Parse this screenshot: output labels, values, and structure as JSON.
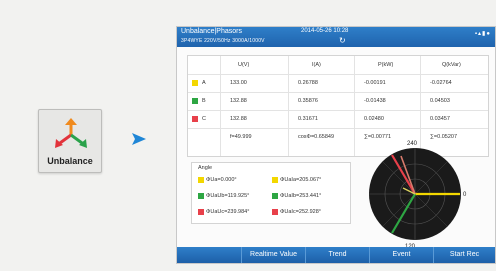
{
  "launcher": {
    "label": "Unbalance"
  },
  "device": {
    "title": "Unbalance|Phasors",
    "datetime": "2014-05-26 10:28",
    "subtitle": "3P4WYE 220V/50Hz 3000A/1000V",
    "status_icons": "▪▴▮●",
    "table": {
      "headers": [
        "U(V)",
        "I(A)",
        "P(kW)",
        "Q(kVar)"
      ],
      "rows": [
        {
          "phase": "A",
          "color": "#f3d700",
          "u": "133.00",
          "i": "0.26788",
          "p": "-0.00191",
          "q": "-0.02764"
        },
        {
          "phase": "B",
          "color": "#2ea643",
          "u": "132.88",
          "i": "0.35876",
          "p": "-0.01438",
          "q": "0.04503"
        },
        {
          "phase": "C",
          "color": "#e8404a",
          "u": "132.88",
          "i": "0.31671",
          "p": "0.02480",
          "q": "0.03457"
        }
      ],
      "summary": {
        "f": "f=49.999",
        "pf": "cosΦ=0.65849",
        "sum_p": "∑=0.00771",
        "sum_q": "∑=0.05207"
      }
    },
    "angle": {
      "title": "Angle",
      "items": [
        {
          "text": "ΦUa=0.000°",
          "color": "#f3d700"
        },
        {
          "text": "ΦUaIa=205.067°",
          "color": "#f3d700"
        },
        {
          "text": "ΦUaUb=119.925°",
          "color": "#2ea643"
        },
        {
          "text": "ΦUaIb=253.441°",
          "color": "#2ea643"
        },
        {
          "text": "ΦUaUc=239.984°",
          "color": "#e8404a"
        },
        {
          "text": "ΦUaIc=252.928°",
          "color": "#e8404a"
        }
      ]
    },
    "polar": {
      "top_label": "240",
      "bottom_label": "120",
      "right_label": "0"
    },
    "menu": [
      "Realtime Value",
      "Trend",
      "Event",
      "Start Rec"
    ]
  },
  "colors": {
    "accent": "#1f6fbf",
    "phase_a": "#f3d700",
    "phase_b": "#2ea643",
    "phase_c": "#e8404a"
  }
}
